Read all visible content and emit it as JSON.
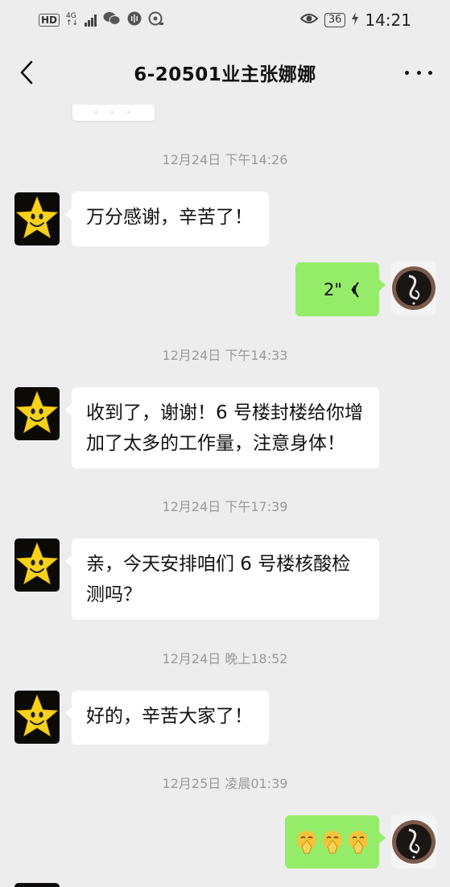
{
  "status_bar": {
    "hd": "HD",
    "network": "4G",
    "network_sub": "↑↓",
    "battery": "36",
    "time": "14:21",
    "icons": [
      "wechat-icon",
      "voice-assistant-icon",
      "nfc-icon",
      "eye-comfort-icon",
      "charging-icon"
    ]
  },
  "nav": {
    "title": "6-20501业主张娜娜",
    "back_icon": "chevron-left-icon",
    "more_icon": "more-dots-icon"
  },
  "messages": [
    {
      "kind": "timestamp",
      "text": "12月24日 下午14:26"
    },
    {
      "kind": "text",
      "direction": "in",
      "text": "万分感谢，辛苦了！"
    },
    {
      "kind": "voice",
      "direction": "out",
      "duration": "2\""
    },
    {
      "kind": "timestamp",
      "text": "12月24日 下午14:33"
    },
    {
      "kind": "text",
      "direction": "in",
      "text": "收到了，谢谢！6 号楼封楼给你增加了太多的工作量，注意身体！"
    },
    {
      "kind": "timestamp",
      "text": "12月24日 下午17:39"
    },
    {
      "kind": "text",
      "direction": "in",
      "text": "亲，今天安排咱们 6 号楼核酸检测吗？"
    },
    {
      "kind": "timestamp",
      "text": "12月24日 晚上18:52"
    },
    {
      "kind": "text",
      "direction": "in",
      "text": "好的，辛苦大家了！"
    },
    {
      "kind": "timestamp",
      "text": "12月25日 凌晨01:39"
    },
    {
      "kind": "emoji",
      "direction": "out",
      "icons": [
        "praying-emoji",
        "praying-emoji",
        "praying-emoji"
      ]
    }
  ],
  "colors": {
    "background": "#ededed",
    "outgoing_bubble": "#95ec69",
    "incoming_bubble": "#ffffff",
    "timestamp_text": "#9a9a9a"
  }
}
